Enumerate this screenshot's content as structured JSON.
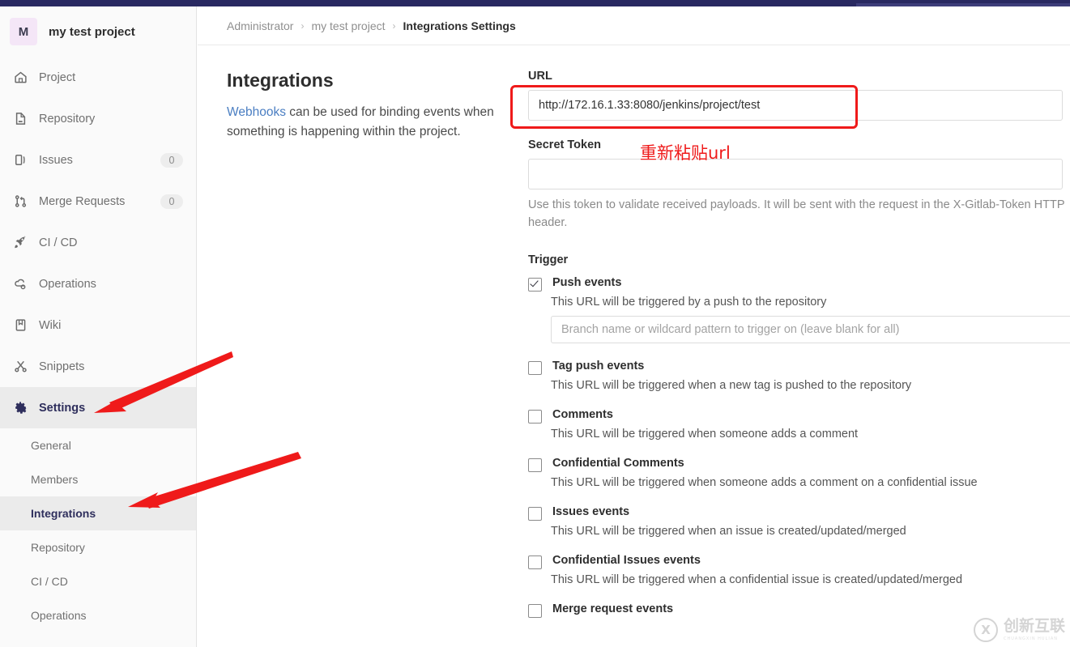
{
  "navbar": {
    "accent_color": "#292961"
  },
  "sidebar": {
    "project": {
      "initial": "M",
      "name": "my test project"
    },
    "items": [
      {
        "label": "Project",
        "icon": "home-icon",
        "badge": null,
        "active": false
      },
      {
        "label": "Repository",
        "icon": "document-icon",
        "badge": null,
        "active": false
      },
      {
        "label": "Issues",
        "icon": "issues-icon",
        "badge": "0",
        "active": false
      },
      {
        "label": "Merge Requests",
        "icon": "merge-request-icon",
        "badge": "0",
        "active": false
      },
      {
        "label": "CI / CD",
        "icon": "rocket-icon",
        "badge": null,
        "active": false
      },
      {
        "label": "Operations",
        "icon": "cloud-gear-icon",
        "badge": null,
        "active": false
      },
      {
        "label": "Wiki",
        "icon": "book-icon",
        "badge": null,
        "active": false
      },
      {
        "label": "Snippets",
        "icon": "scissors-icon",
        "badge": null,
        "active": false
      },
      {
        "label": "Settings",
        "icon": "gear-icon",
        "badge": null,
        "active": true
      }
    ],
    "subitems": [
      {
        "label": "General",
        "active": false
      },
      {
        "label": "Members",
        "active": false
      },
      {
        "label": "Integrations",
        "active": true
      },
      {
        "label": "Repository",
        "active": false
      },
      {
        "label": "CI / CD",
        "active": false
      },
      {
        "label": "Operations",
        "active": false
      }
    ]
  },
  "breadcrumb": {
    "root": "Administrator",
    "project": "my test project",
    "current": "Integrations Settings",
    "separator": "›"
  },
  "page": {
    "title": "Integrations",
    "desc_link": "Webhooks",
    "desc_rest": " can be used for binding events when something is happening within the project."
  },
  "form": {
    "url": {
      "label": "URL",
      "value": "http://172.16.1.33:8080/jenkins/project/test"
    },
    "secret_token": {
      "label": "Secret Token",
      "value": "",
      "placeholder": "",
      "help": "Use this token to validate received payloads. It will be sent with the request in the X-Gitlab-Token HTTP header."
    },
    "trigger_title": "Trigger",
    "triggers": [
      {
        "name": "Push events",
        "desc": "This URL will be triggered by a push to the repository",
        "checked": true,
        "branch_placeholder": "Branch name or wildcard pattern to trigger on (leave blank for all)",
        "branch_value": ""
      },
      {
        "name": "Tag push events",
        "desc": "This URL will be triggered when a new tag is pushed to the repository",
        "checked": false
      },
      {
        "name": "Comments",
        "desc": "This URL will be triggered when someone adds a comment",
        "checked": false
      },
      {
        "name": "Confidential Comments",
        "desc": "This URL will be triggered when someone adds a comment on a confidential issue",
        "checked": false
      },
      {
        "name": "Issues events",
        "desc": "This URL will be triggered when an issue is created/updated/merged",
        "checked": false
      },
      {
        "name": "Confidential Issues events",
        "desc": "This URL will be triggered when a confidential issue is created/updated/merged",
        "checked": false
      },
      {
        "name": "Merge request events",
        "desc": "",
        "checked": false
      }
    ]
  },
  "annotations": {
    "note_text": "重新粘贴url",
    "color": "#ef1a1a"
  },
  "watermark": {
    "logo": "✂",
    "text": "创新互联",
    "sub": "CHUANGXIN HULIAN"
  }
}
